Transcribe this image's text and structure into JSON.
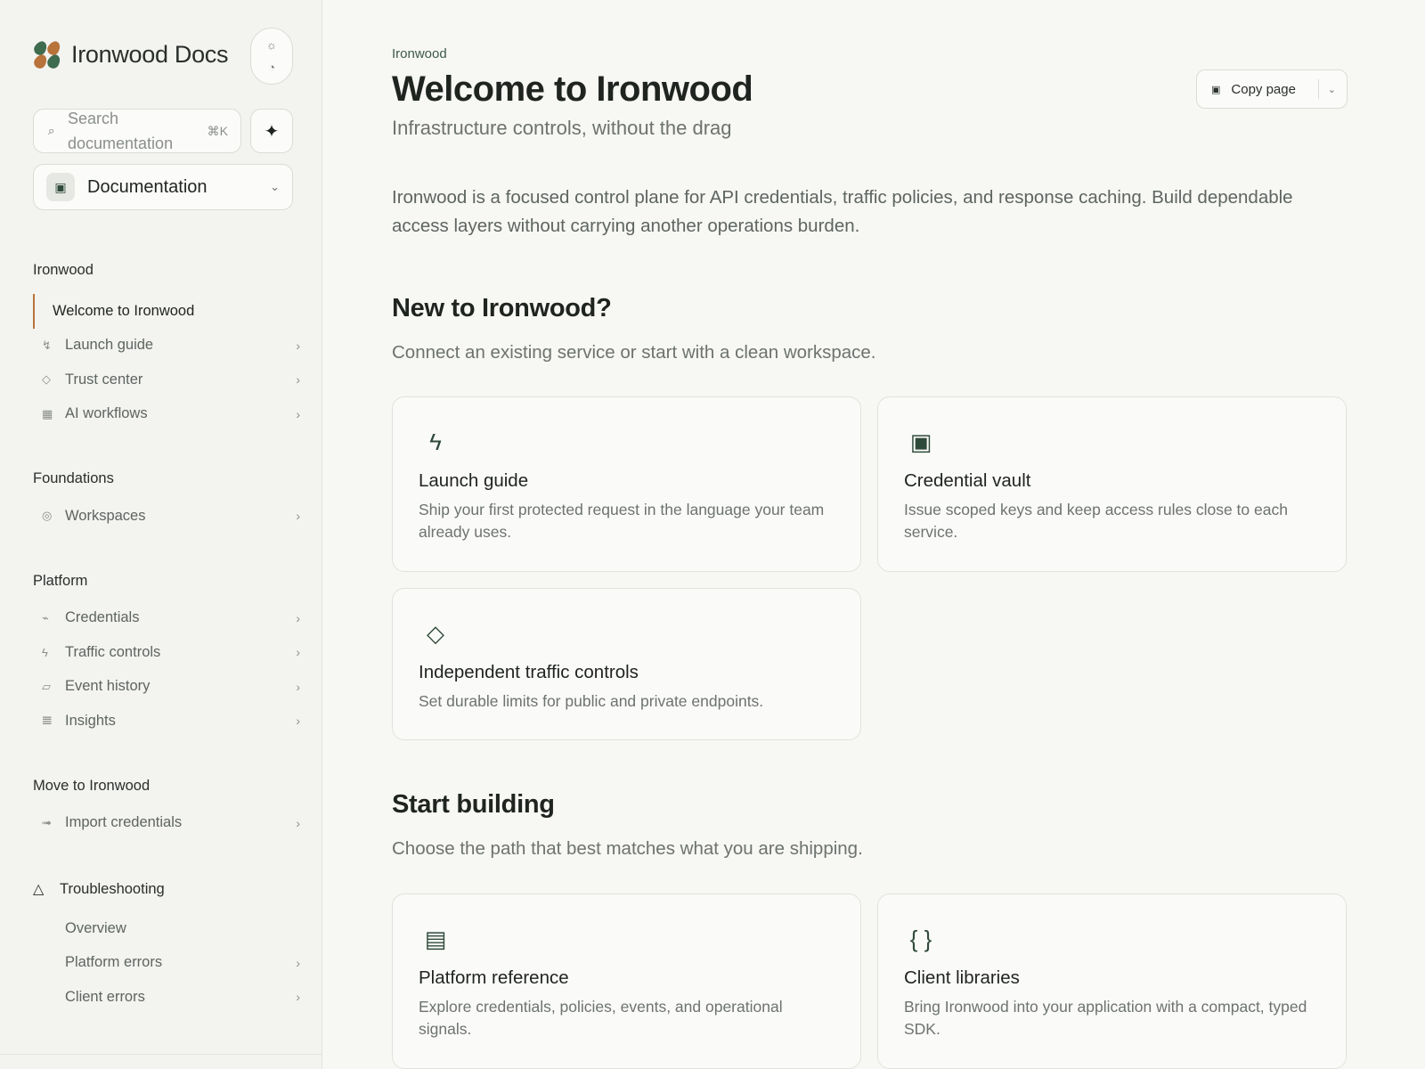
{
  "brand": {
    "name": "Ironwood Docs"
  },
  "theme_toggle": {
    "light_icon": "☼",
    "dark_icon": "◔"
  },
  "search": {
    "icon": "⌕",
    "placeholder": "Search documentation",
    "shortcut": "⌘K"
  },
  "ai_button": {
    "icon": "✦"
  },
  "doc_selector": {
    "icon": "▣",
    "label": "Documentation",
    "chevron": "⌄"
  },
  "nav": {
    "ironwood": {
      "title": "Ironwood",
      "items": [
        {
          "label": "Welcome to Ironwood",
          "icon": "",
          "active": true
        },
        {
          "label": "Launch guide",
          "icon": "↯"
        },
        {
          "label": "Trust center",
          "icon": "◇"
        },
        {
          "label": "AI workflows",
          "icon": "▦"
        }
      ]
    },
    "foundations": {
      "title": "Foundations",
      "items": [
        {
          "label": "Workspaces",
          "icon": "◎"
        }
      ]
    },
    "platform": {
      "title": "Platform",
      "items": [
        {
          "label": "Credentials",
          "icon": "⌁"
        },
        {
          "label": "Traffic controls",
          "icon": "ϟ"
        },
        {
          "label": "Event history",
          "icon": "▱"
        },
        {
          "label": "Insights",
          "icon": "𝌆"
        }
      ]
    },
    "move": {
      "title": "Move to Ironwood",
      "items": [
        {
          "label": "Import credentials",
          "icon": "➟"
        }
      ]
    },
    "troubleshooting": {
      "title": "Troubleshooting",
      "icon": "△",
      "items": [
        {
          "label": "Overview"
        },
        {
          "label": "Platform errors"
        },
        {
          "label": "Client errors"
        }
      ]
    },
    "chevron": "›"
  },
  "main": {
    "breadcrumb": "Ironwood",
    "title": "Welcome to Ironwood",
    "subtitle": "Infrastructure controls, without the drag",
    "copy_page": {
      "icon": "▣",
      "label": "Copy page",
      "chevron": "⌄"
    },
    "intro": "Ironwood is a focused control plane for API credentials, traffic policies, and response caching. Build dependable access layers without carrying another operations burden.",
    "new_section": {
      "title": "New to Ironwood?",
      "subtitle": "Connect an existing service or start with a clean workspace.",
      "cards": [
        {
          "icon": "ϟ",
          "title": "Launch guide",
          "desc": "Ship your first protected request in the language your team already uses."
        },
        {
          "icon": "▣",
          "title": "Credential vault",
          "desc": "Issue scoped keys and keep access rules close to each service."
        },
        {
          "icon": "◇",
          "title": "Independent traffic controls",
          "desc": "Set durable limits for public and private endpoints."
        }
      ]
    },
    "build_section": {
      "title": "Start building",
      "subtitle": "Choose the path that best matches what you are shipping.",
      "cards": [
        {
          "icon": "▤",
          "title": "Platform reference",
          "desc": "Explore credentials, policies, events, and operational signals."
        },
        {
          "icon": "{ }",
          "title": "Client libraries",
          "desc": "Bring Ironwood into your application with a compact, typed SDK."
        }
      ]
    }
  }
}
